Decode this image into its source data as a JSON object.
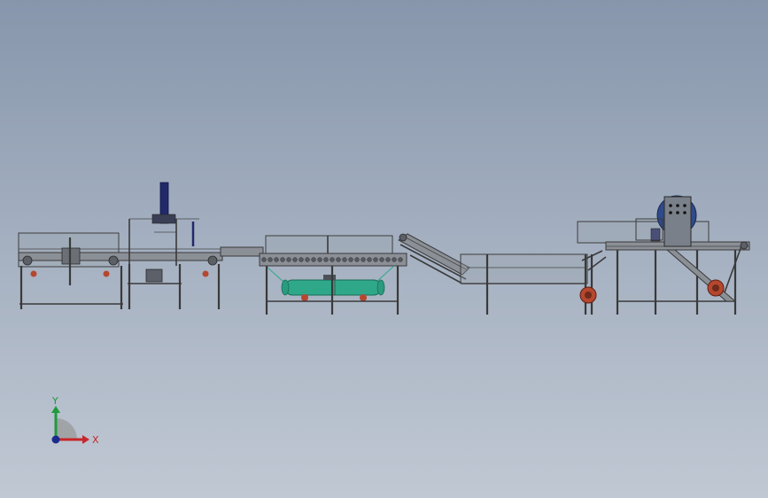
{
  "colors": {
    "frame": "#3a3a3a",
    "tank": "#2fa88a",
    "motor_red": "#b5472f",
    "column_blue": "#22296b",
    "axis_x": "#c8262b",
    "axis_y": "#1f9a3c",
    "axis_z": "#1b2b8c"
  },
  "triad": {
    "x_label": "X",
    "y_label": "Y"
  }
}
